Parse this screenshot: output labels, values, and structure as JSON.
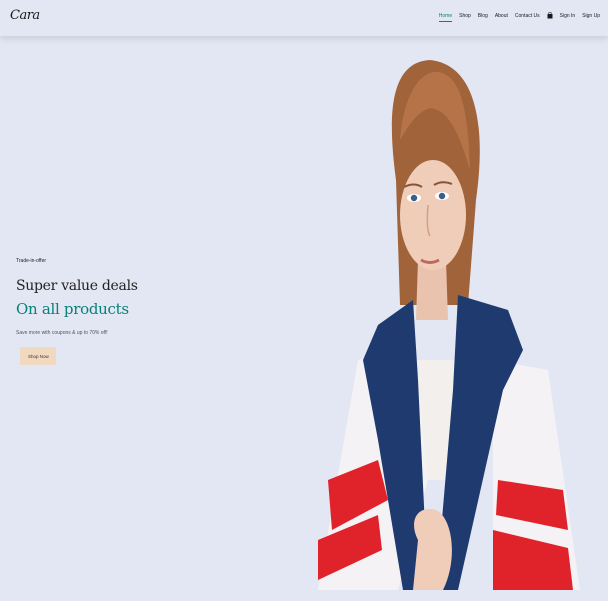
{
  "header": {
    "logo_text": "Cara",
    "nav": [
      {
        "label": "Home",
        "active": true
      },
      {
        "label": "Shop"
      },
      {
        "label": "Blog"
      },
      {
        "label": "About"
      },
      {
        "label": "Contact Us"
      },
      {
        "label": "cart-icon",
        "icon": true
      },
      {
        "label": "Sign In"
      },
      {
        "label": "Sign Up"
      }
    ]
  },
  "hero": {
    "tagline": "Trade-in-offer",
    "headline": "Super value deals",
    "subheadline": "On all products",
    "description": "Save more with coupons & up to 70% off!",
    "button_label": "Shop Now",
    "colors": {
      "background": "#e3e6f3",
      "accent": "#088178",
      "button_bg": "#f1d9c0"
    }
  }
}
